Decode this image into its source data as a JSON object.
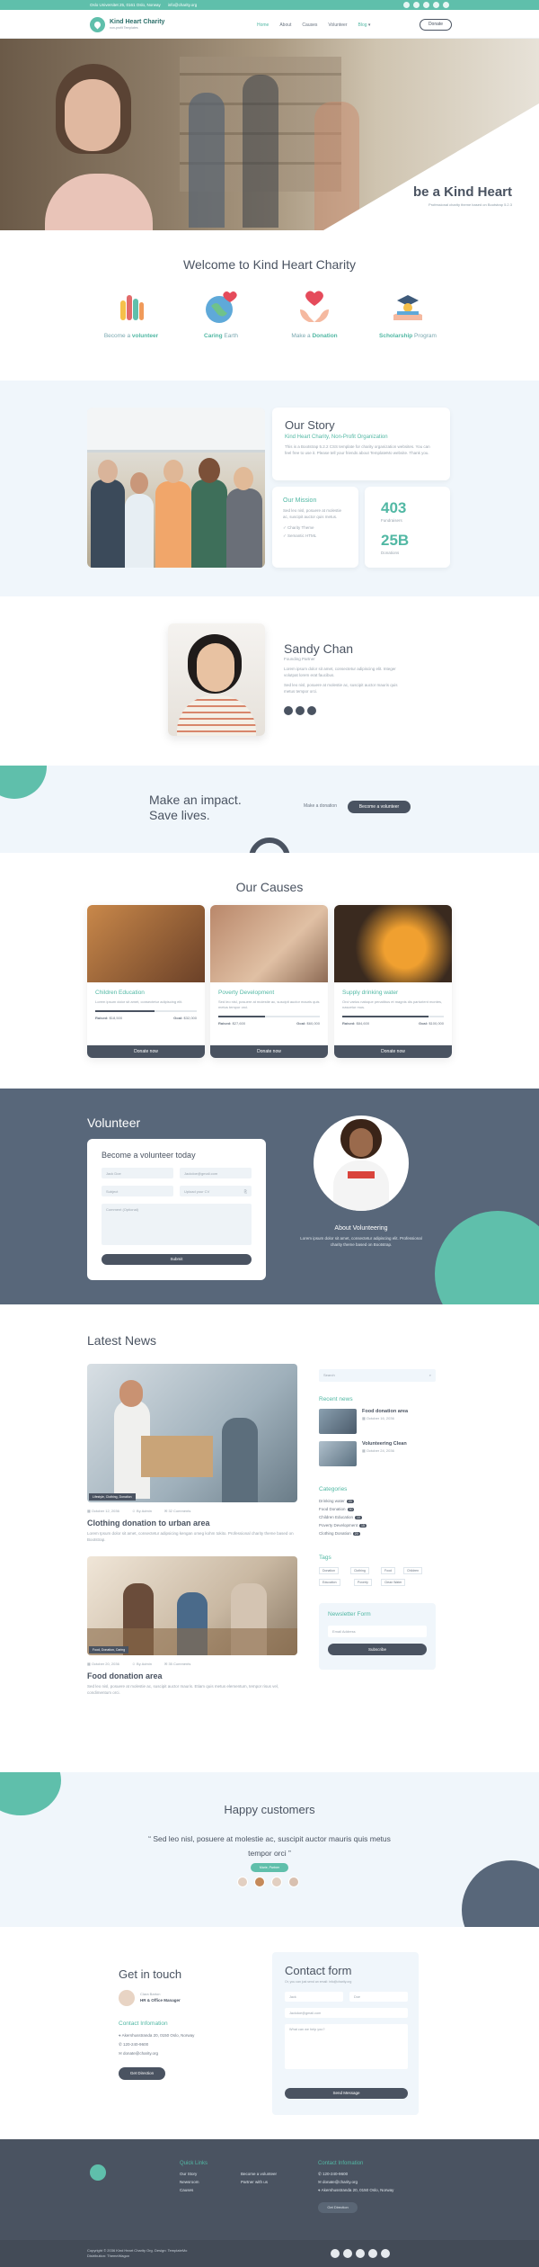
{
  "topbar": {
    "address": "Oslo Universitet 25, 0161 Oslo, Norway",
    "email": "info@charity.org"
  },
  "nav": {
    "brand": "Kind Heart Charity",
    "tagline": "non-profit Templates",
    "items": [
      "Home",
      "About",
      "Causes",
      "Volunteer",
      "Blog"
    ],
    "donate": "Donate"
  },
  "hero": {
    "title": "be a Kind Heart",
    "subtitle": "Professional charity theme based on Bootstrap 5.2.3"
  },
  "welcome": {
    "title": "Welcome to Kind Heart Charity",
    "features": [
      {
        "pre": "Become a ",
        "em": "volunteer",
        "post": ""
      },
      {
        "pre": "",
        "em": "Caring",
        "post": " Earth"
      },
      {
        "pre": "Make a ",
        "em": "Donation",
        "post": ""
      },
      {
        "pre": "",
        "em": "Scholarship",
        "post": " Program"
      }
    ]
  },
  "story": {
    "title": "Our Story",
    "subtitle": "Kind Heart Charity, Non-Profit Organization",
    "text": "This is a Bootstrap 5.2.2 CSS template for charity organization websites. You can feel free to use it. Please tell your friends about TemplateMo website. Thank you.",
    "mission_title": "Our Mission",
    "mission_text": "Sed leo nisl, posuere at molestie ac, suscipit auctor quis metus.",
    "mission_items": [
      "Charity Theme",
      "Semantic HTML"
    ],
    "stat1_num": "403",
    "stat1_label": "Fundraisers",
    "stat2_num": "25B",
    "stat2_label": "Donations"
  },
  "founder": {
    "name": "Sandy Chan",
    "role": "Founding Partner",
    "bio1": "Lorem ipsum dolor sit amet, consectetur adipiscing elit. Integer volutpat lorem erat faucibus.",
    "bio2": "Sed leo nisl, posuere at molestie ac, suscipit auctor mauris quis metus tempor orci."
  },
  "impact": {
    "title1": "Make an impact.",
    "title2": "Save lives.",
    "make": "Make a donation",
    "volunteer": "Become a volunteer"
  },
  "causes": {
    "title": "Our Causes",
    "raised_label": "Raised:",
    "goal_label": "Goal:",
    "donate": "Donate now",
    "items": [
      {
        "title": "Children Education",
        "text": "Lorem ipsum dolor sit amet, consectetur adipiscing elit.",
        "raised": "$18,500",
        "goal": "$32,000",
        "pct": 0.58
      },
      {
        "title": "Poverty Development",
        "text": "Sed leo nisl, posuere at molestie ac, suscipit auctor mauris quis metus tempor orci.",
        "raised": "$27,600",
        "goal": "$60,000",
        "pct": 0.46
      },
      {
        "title": "Supply drinking water",
        "text": "Orci varius natoque penatibus et magnis dis parturient montes, nascetur mus.",
        "raised": "$84,600",
        "goal": "$100,000",
        "pct": 0.85
      }
    ]
  },
  "volunteer": {
    "title": "Volunteer",
    "form_title": "Become a volunteer today",
    "name": "Jack Doe",
    "email": "Jackdoe@gmail.com",
    "subject": "Subject",
    "upload": "Upload your CV",
    "comment": "Comment (Optional)",
    "submit": "Submit",
    "about_title": "About Volunteering",
    "about_text": "Lorem ipsum dolor sit amet, consectetur adipiscing elit. Professional charity theme based on Bootstrap."
  },
  "news": {
    "title": "Latest News",
    "posts": [
      {
        "tags": "Lifestyle, Clothing, Donation",
        "date": "October 12, 2036",
        "author": "By Admin",
        "comments": "32 Comments",
        "title": "Clothing donation to urban area",
        "text": "Lorem Ipsum dolor sit amet, consectetur adipsicing kengan omeg kohm tokito. Professional charity theme based on Bootstrap."
      },
      {
        "tags": "Food, Donation, Caring",
        "date": "October 20, 2036",
        "author": "By Admin",
        "comments": "35 Comments",
        "title": "Food donation area",
        "text": "Sed leo nisl, posuere at molestie ac, suscipit auctor mauris. Etiam quis metus elementum, tempor risus vel, condimentum orci."
      }
    ],
    "search": "Search",
    "recent_title": "Recent news",
    "recent": [
      {
        "title": "Food donation area",
        "date": "October 16, 2036"
      },
      {
        "title": "Volunteering Clean",
        "date": "October 24, 2036"
      }
    ],
    "cat_title": "Categories",
    "cats": [
      {
        "n": "Drinking water",
        "c": "20"
      },
      {
        "n": "Food Donation",
        "c": "30"
      },
      {
        "n": "Children Education",
        "c": "10"
      },
      {
        "n": "Poverty Development",
        "c": "15"
      },
      {
        "n": "Clothing Donation",
        "c": "20"
      }
    ],
    "tag_title": "Tags",
    "tags": [
      "Donation",
      "Clothing",
      "Food",
      "Children",
      "Education",
      "Poverty",
      "Clean Water"
    ],
    "nl_title": "Newsletter Form",
    "nl_email": "Email Address",
    "nl_btn": "Subscribe"
  },
  "happy": {
    "title": "Happy customers",
    "quote": "Sed leo nisl, posuere at molestie ac, suscipit auctor mauris quis metus tempor orci",
    "name": "Marie, Partner"
  },
  "contact": {
    "title": "Get in touch",
    "person": "Clara Barton",
    "person_role": "HR & Office Manager",
    "info_title": "Contact Infomation",
    "addr": "Akershusstranda 20, 0150 Oslo, Norway",
    "phone": "120-240-9600",
    "mail": "donate@charity.org",
    "dir": "Get Direction",
    "form_title": "Contact form",
    "form_note": "Or, you can just send an email: info@charity.org",
    "first": "Jack",
    "last": "Doe",
    "email": "Jackdoe@gmail.com",
    "msg": "What can we help you?",
    "send": "Send Message"
  },
  "footer": {
    "ql_title": "Quick Links",
    "links": [
      "Our Story",
      "Newsroom",
      "Causes",
      "Become a volunteer",
      "Partner with us"
    ],
    "ci_title": "Contact Infomation",
    "phone": "120-240-9600",
    "mail": "donate@charity.org",
    "addr": "Akershusstranda 20, 0150 Oslo, Norway",
    "dir": "Get Direction",
    "copy": "Copyright © 2036 Kind Heart Charity Org. Design: TemplateMo",
    "dist": "Distribution: ThemeWagon"
  }
}
